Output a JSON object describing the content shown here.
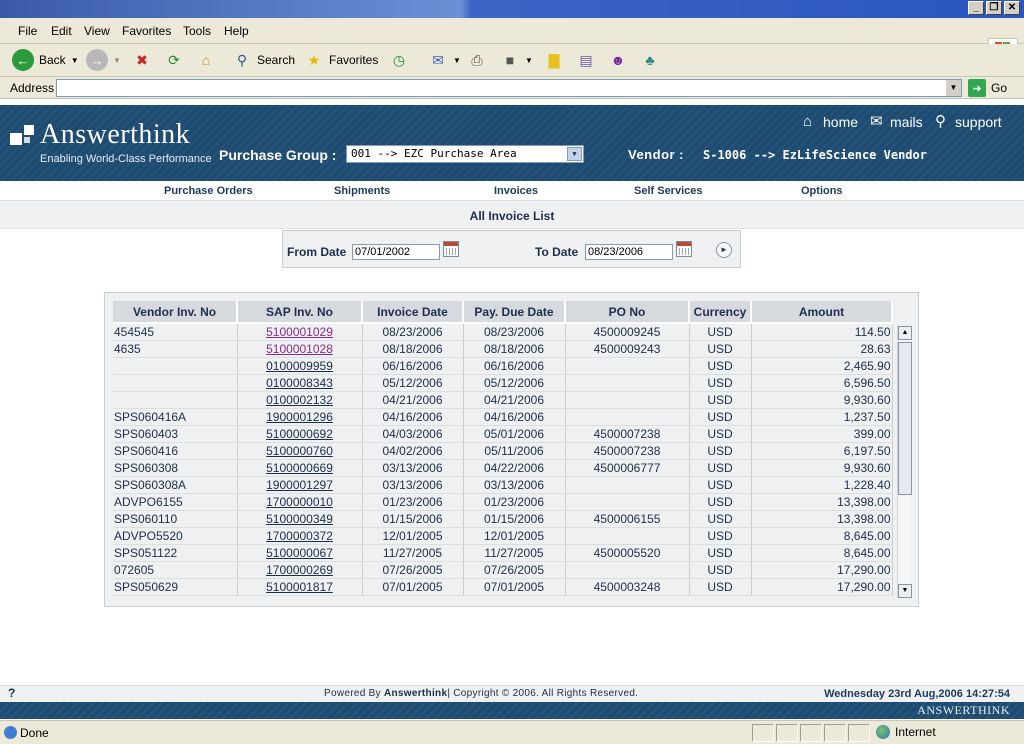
{
  "browser": {
    "menu": [
      "File",
      "Edit",
      "View",
      "Favorites",
      "Tools",
      "Help"
    ],
    "toolbar": {
      "back": "Back",
      "search": "Search",
      "favorites": "Favorites"
    },
    "address_label": "Address",
    "address_value": "",
    "go_label": "Go",
    "status_text": "Done",
    "zone_text": "Internet"
  },
  "header": {
    "logo_text": "Answerthink",
    "tagline": "Enabling World-Class Performance",
    "purchase_group_label": "Purchase Group :",
    "purchase_group_value": "001 --> EZC Purchase Area",
    "vendor_label": "Vendor :",
    "vendor_value": "S-1006 --> EzLifeScience Vendor",
    "links": {
      "home": "home",
      "mails": "mails",
      "support": "support"
    }
  },
  "nav": [
    "Purchase Orders",
    "Shipments",
    "Invoices",
    "Self Services",
    "Options"
  ],
  "page_title": "All Invoice List",
  "filters": {
    "from_label": "From Date",
    "from_value": "07/01/2002",
    "to_label": "To Date",
    "to_value": "08/23/2006"
  },
  "table": {
    "columns": [
      "Vendor Inv. No",
      "SAP Inv. No",
      "Invoice Date",
      "Pay. Due Date",
      "PO No",
      "Currency",
      "Amount"
    ],
    "rows": [
      [
        "454545",
        "5100001029",
        "08/23/2006",
        "08/23/2006",
        "4500009245",
        "USD",
        "114.50"
      ],
      [
        "4635",
        "5100001028",
        "08/18/2006",
        "08/18/2006",
        "4500009243",
        "USD",
        "28.63"
      ],
      [
        "",
        "0100009959",
        "06/16/2006",
        "06/16/2006",
        "",
        "USD",
        "2,465.90"
      ],
      [
        "",
        "0100008343",
        "05/12/2006",
        "05/12/2006",
        "",
        "USD",
        "6,596.50"
      ],
      [
        "",
        "0100002132",
        "04/21/2006",
        "04/21/2006",
        "",
        "USD",
        "9,930.60"
      ],
      [
        "SPS060416A",
        "1900001296",
        "04/16/2006",
        "04/16/2006",
        "",
        "USD",
        "1,237.50"
      ],
      [
        "SPS060403",
        "5100000692",
        "04/03/2006",
        "05/01/2006",
        "4500007238",
        "USD",
        "399.00"
      ],
      [
        "SPS060416",
        "5100000760",
        "04/02/2006",
        "05/11/2006",
        "4500007238",
        "USD",
        "6,197.50"
      ],
      [
        "SPS060308",
        "5100000669",
        "03/13/2006",
        "04/22/2006",
        "4500006777",
        "USD",
        "9,930.60"
      ],
      [
        "SPS060308A",
        "1900001297",
        "03/13/2006",
        "03/13/2006",
        "",
        "USD",
        "1,228.40"
      ],
      [
        "ADVPO6155",
        "1700000010",
        "01/23/2006",
        "01/23/2006",
        "",
        "USD",
        "13,398.00"
      ],
      [
        "SPS060110",
        "5100000349",
        "01/15/2006",
        "01/15/2006",
        "4500006155",
        "USD",
        "13,398.00"
      ],
      [
        "ADVPO5520",
        "1700000372",
        "12/01/2005",
        "12/01/2005",
        "",
        "USD",
        "8,645.00"
      ],
      [
        "SPS051122",
        "5100000067",
        "11/27/2005",
        "11/27/2005",
        "4500005520",
        "USD",
        "8,645.00"
      ],
      [
        "072605",
        "1700000269",
        "07/26/2005",
        "07/26/2005",
        "",
        "USD",
        "17,290.00"
      ],
      [
        "SPS050629",
        "5100001817",
        "07/01/2005",
        "07/01/2005",
        "4500003248",
        "USD",
        "17,290.00"
      ]
    ],
    "visited_rows": [
      0,
      1
    ]
  },
  "footer": {
    "help": "?",
    "powered_prefix": "Powered By ",
    "powered_brand": "Answerthink",
    "copyright": "| Copyright © 2006. All Rights Reserved.",
    "datetime": "Wednesday 23rd Aug,2006 14:27:54",
    "bottom_logo": "ANSWERTHINK"
  },
  "colors": {
    "header_bg": "#1d4b72",
    "text_primary": "#1d2f4a",
    "visited_link": "#8a2b8a",
    "panel_bg": "#eef0f2"
  }
}
